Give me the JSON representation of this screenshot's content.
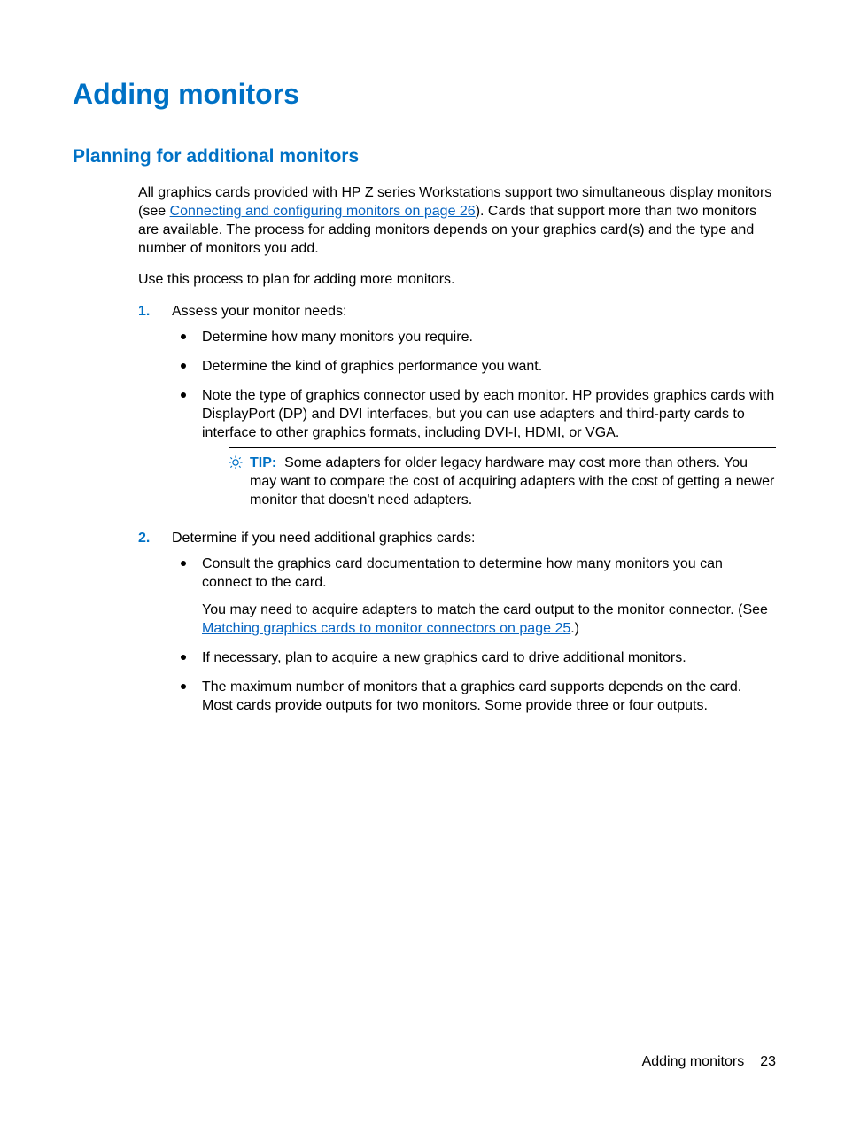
{
  "title": "Adding monitors",
  "subtitle": "Planning for additional monitors",
  "intro": {
    "p1a": "All graphics cards provided with HP Z series Workstations support two simultaneous display monitors (see ",
    "p1link": "Connecting and configuring monitors on page 26",
    "p1b": "). Cards that support more than two monitors are available. The process for adding monitors depends on your graphics card(s) and the type and number of monitors you add.",
    "p2": "Use this process to plan for adding more monitors."
  },
  "steps": {
    "s1": {
      "num": "1.",
      "text": "Assess your monitor needs:",
      "b1": "Determine how many monitors you require.",
      "b2": "Determine the kind of graphics performance you want.",
      "b3": "Note the type of graphics connector used by each monitor. HP provides graphics cards with DisplayPort (DP) and DVI interfaces, but you can use adapters and third-party cards to interface to other graphics formats, including DVI-I, HDMI, or VGA.",
      "tip": {
        "label": "TIP:",
        "text": "Some adapters for older legacy hardware may cost more than others. You may want to compare the cost of acquiring adapters with the cost of getting a newer monitor that doesn't need adapters."
      }
    },
    "s2": {
      "num": "2.",
      "text": "Determine if you need additional graphics cards:",
      "b1": "Consult the graphics card documentation to determine how many monitors you can connect to the card.",
      "b1p_a": "You may need to acquire adapters to match the card output to the monitor connector. (See ",
      "b1p_link": "Matching graphics cards to monitor connectors on page 25",
      "b1p_b": ".)",
      "b2": "If necessary, plan to acquire a new graphics card to drive additional monitors.",
      "b3": "The maximum number of monitors that a graphics card supports depends on the card. Most cards provide outputs for two monitors. Some provide three or four outputs."
    }
  },
  "footer": {
    "label": "Adding monitors",
    "page": "23"
  }
}
